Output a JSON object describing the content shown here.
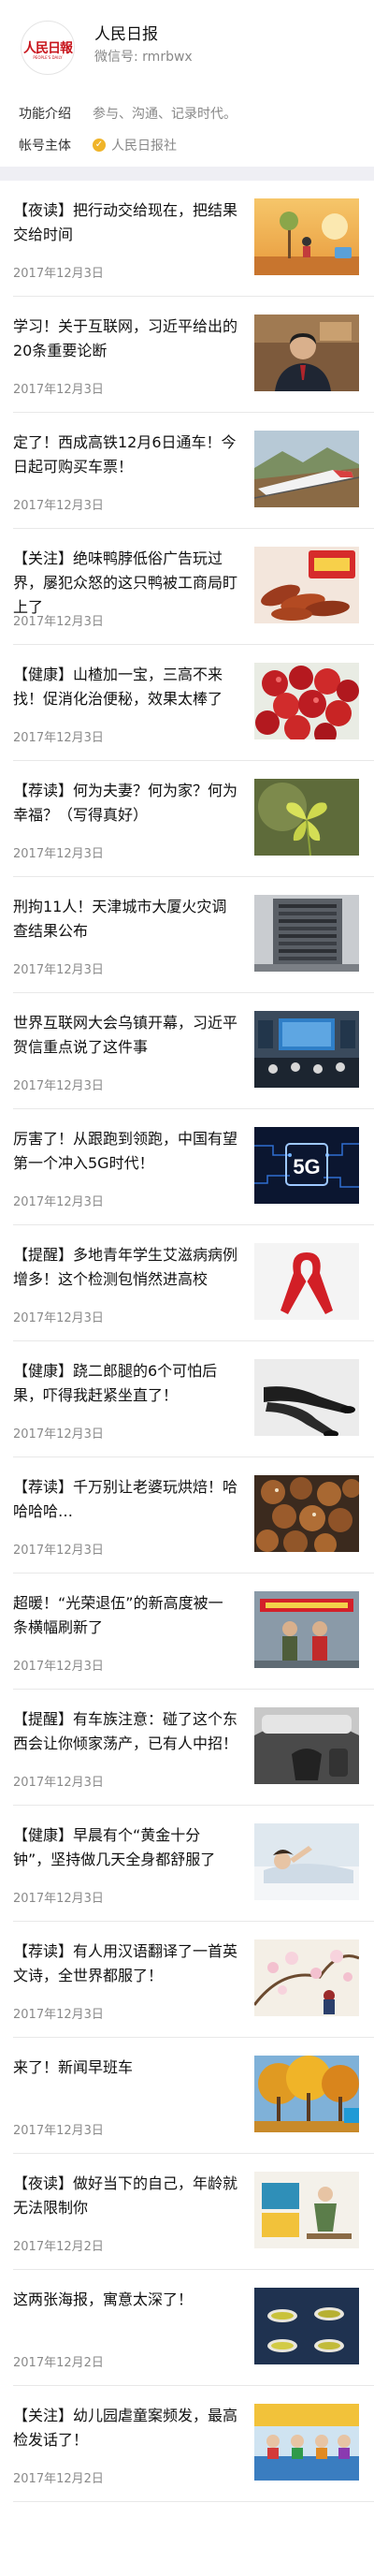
{
  "account": {
    "name": "人民日报",
    "wechat_id": "微信号: rmrbwx",
    "avatar_text": "人民日報",
    "avatar_sub": "PEOPLE'S DAILY"
  },
  "info": {
    "intro_label": "功能介绍",
    "intro_value": "参与、沟通、记录时代。",
    "owner_label": "帐号主体",
    "owner_value": "人民日报社"
  },
  "articles": [
    {
      "title": "【夜读】把行动交给现在，把结果交给时间",
      "date": "2017年12月3日"
    },
    {
      "title": "学习！关于互联网，习近平给出的20条重要论断",
      "date": "2017年12月3日"
    },
    {
      "title": "定了！西成高铁12月6日通车！今日起可购买车票！",
      "date": "2017年12月3日"
    },
    {
      "title": "【关注】绝味鸭脖低俗广告玩过界，屡犯众怒的这只鸭被工商局盯上了",
      "date": "2017年12月3日"
    },
    {
      "title": "【健康】山楂加一宝，三高不来找！促消化治便秘，效果太棒了",
      "date": "2017年12月3日"
    },
    {
      "title": "【荐读】何为夫妻？何为家？何为幸福？（写得真好）",
      "date": "2017年12月3日"
    },
    {
      "title": "刑拘11人！天津城市大厦火灾调查结果公布",
      "date": "2017年12月3日"
    },
    {
      "title": "世界互联网大会乌镇开幕，习近平贺信重点说了这件事",
      "date": "2017年12月3日"
    },
    {
      "title": "厉害了！从跟跑到领跑，中国有望第一个冲入5G时代！",
      "date": "2017年12月3日"
    },
    {
      "title": "【提醒】多地青年学生艾滋病病例增多！这个检测包悄然进高校",
      "date": "2017年12月3日"
    },
    {
      "title": "【健康】跷二郎腿的6个可怕后果，吓得我赶紧坐直了！",
      "date": "2017年12月3日"
    },
    {
      "title": "【荐读】千万别让老婆玩烘焙！哈哈哈哈…",
      "date": "2017年12月3日"
    },
    {
      "title": "超暖！“光荣退伍”的新高度被一条横幅刷新了",
      "date": "2017年12月3日"
    },
    {
      "title": "【提醒】有车族注意：碰了这个东西会让你倾家荡产，已有人中招！",
      "date": "2017年12月3日"
    },
    {
      "title": "【健康】早晨有个“黄金十分钟”，坚持做几天全身都舒服了",
      "date": "2017年12月3日"
    },
    {
      "title": "【荐读】有人用汉语翻译了一首英文诗，全世界都服了！",
      "date": "2017年12月3日"
    },
    {
      "title": "来了！新闻早班车",
      "date": "2017年12月3日"
    },
    {
      "title": "【夜读】做好当下的自己，年龄就无法限制你",
      "date": "2017年12月2日"
    },
    {
      "title": "这两张海报，寓意太深了！",
      "date": "2017年12月2日"
    },
    {
      "title": "【关注】幼儿园虐童案频发，最高检发话了！",
      "date": "2017年12月2日"
    }
  ],
  "thumb_labels": {
    "fiveg": "5G"
  },
  "colors": {
    "brand_red": "#c8161d",
    "date_gray": "#8a8a8a",
    "section_gap": "#efeff4",
    "verified_badge": "#f0b429"
  }
}
